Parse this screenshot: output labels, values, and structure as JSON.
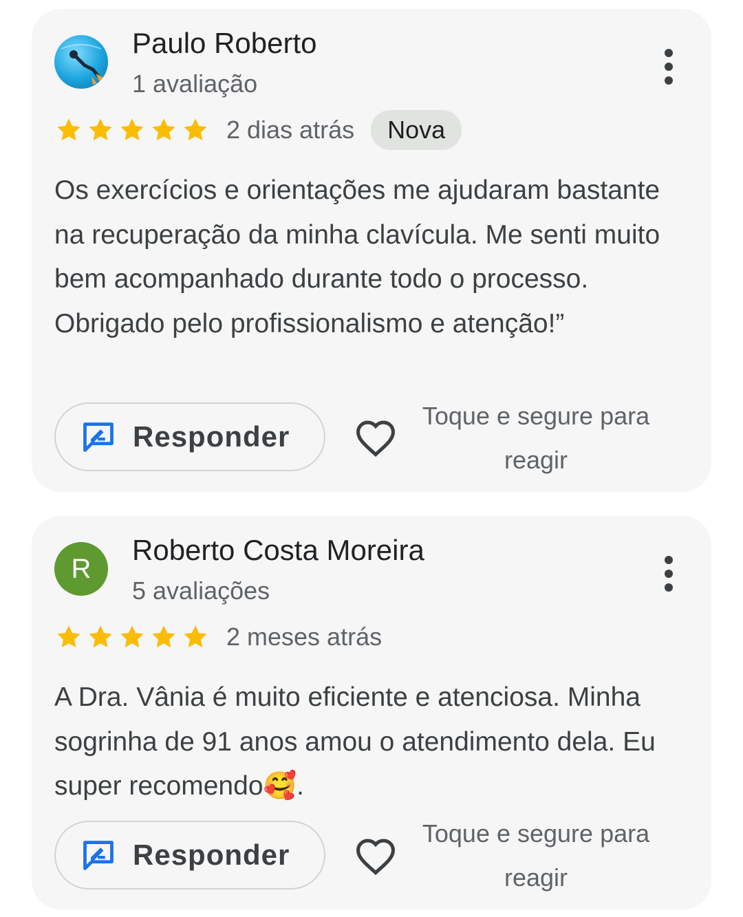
{
  "reviews": [
    {
      "reviewer_name": "Paulo Roberto",
      "review_count": "1 avaliação",
      "avatar_type": "photo",
      "rating": 5,
      "time_ago": "2 dias atrás",
      "badge": "Nova",
      "text": "Os exercícios e orientações me ajudaram bastante na recuperação da minha clavícula. Me senti muito bem acompanhado durante todo o processo. Obrigado pelo profissionalismo e atenção!”",
      "reply_label": "Responder",
      "react_hint": "Toque e segure para reagir"
    },
    {
      "reviewer_name": "Roberto Costa Moreira",
      "review_count": "5 avaliações",
      "avatar_type": "letter",
      "avatar_letter": "R",
      "rating": 5,
      "time_ago": "2 meses atrás",
      "text": "A Dra. Vânia é muito eficiente e atenciosa. Minha sogrinha de 91 anos amou o atendimento dela. Eu super recomendo🥰.",
      "reply_label": "Responder",
      "react_hint": "Toque e segure para reagir"
    }
  ],
  "colors": {
    "card_background": "#f6f6f6",
    "star": "#fbbc04",
    "reply_icon": "#1a73e8",
    "avatar_letter_bg": "#5e9a2f",
    "badge_bg": "#e1e3e1"
  },
  "icons": [
    "more-vert-icon",
    "star-icon",
    "reply-icon",
    "heart-outline-icon"
  ]
}
